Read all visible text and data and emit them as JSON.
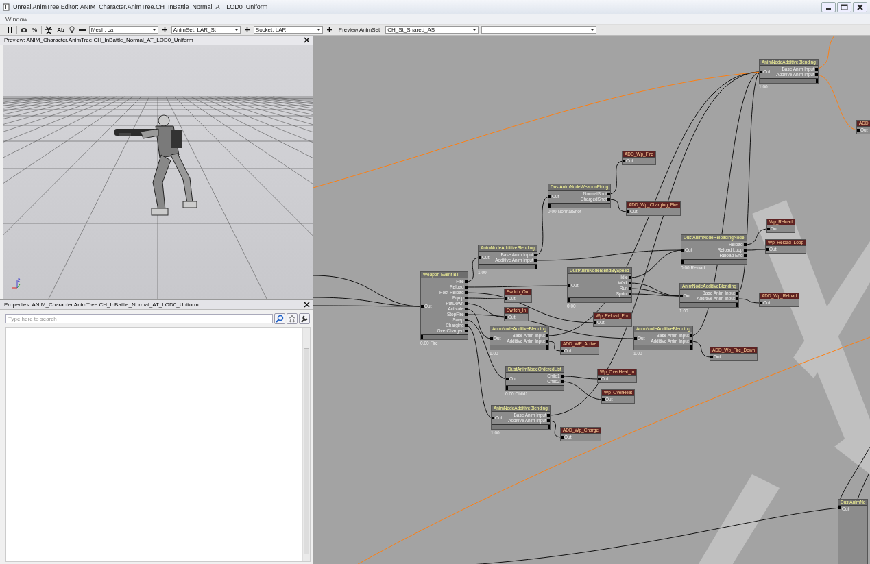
{
  "window": {
    "title": "Unreal AnimTree Editor: ANIM_Character.AnimTree.CH_InBattle_Normal_AT_LOD0_Uniform"
  },
  "menu_bar": [
    "Window"
  ],
  "toolbar": {
    "text_buttons": [
      "%",
      "Ab"
    ],
    "mesh_combo": "Mesh: ca",
    "animset_combo": "AnimSet: LAR_St",
    "socket_combo": "Socket: LAR",
    "preview_animset_label": "Preview AnimSet",
    "preview_animset_combo": "CH_St_Shared_AS"
  },
  "preview_panel": {
    "title": "Preview: ANIM_Character.AnimTree.CH_InBattle_Normal_AT_LOD0_Uniform"
  },
  "properties_panel": {
    "title": "Properties: ANIM_Character.AnimTree.CH_InBattle_Normal_AT_LOD0_Uniform",
    "search": {
      "placeholder": "Type here to search"
    }
  },
  "graph": {
    "nodes": [
      {
        "kind": "blend",
        "title": "AnimNodeAdditiveBlending",
        "out": "Out",
        "inputs": [
          "Base Anim Input",
          "Additive Anim Input"
        ],
        "level": 1,
        "footer": "1.00"
      },
      {
        "kind": "sequence",
        "title": "ADD",
        "out": "Out"
      },
      {
        "kind": "sequence",
        "title": "ADD_Wp_Fire",
        "out": "Out"
      },
      {
        "kind": "blend",
        "title": "DustAnimNodeWeaponFiring",
        "out": "Out",
        "inputs": [
          "NormalShot",
          "ChargedShot"
        ],
        "level": 0,
        "footer": "0.00 NormalShot"
      },
      {
        "kind": "sequence",
        "title": "ADD_Wp_Charging_Fire",
        "out": "Out"
      },
      {
        "kind": "sequence",
        "title": "Wp_Reload",
        "out": "Out"
      },
      {
        "kind": "sequence",
        "title": "Wp_Reload_Loop",
        "out": "Out"
      },
      {
        "kind": "blend",
        "title": "DustAnimNodeReloadingNode",
        "out": "Out",
        "inputs": [
          "Reload",
          "Reload Loop",
          "Reload End"
        ],
        "level": 0,
        "footer": "0.00 Reload"
      },
      {
        "kind": "blend",
        "title": "AnimNodeAdditiveBlending",
        "out": "Out",
        "inputs": [
          "Base Anim Input",
          "Additive Anim Input"
        ],
        "level": 1,
        "footer": "1.00"
      },
      {
        "kind": "blend",
        "title": "DustAnimNodeBlendBySpeed",
        "out": "Out",
        "inputs": [
          "Idle",
          "Walk",
          "Run",
          "Sprint"
        ],
        "level": 0,
        "footer": "0.00"
      },
      {
        "kind": "blend",
        "title": "Weapon Event BT",
        "out": "Out",
        "inputs": [
          "Fire",
          "Reload",
          "Post Reload",
          "Equip",
          "PutDown",
          "Activate",
          "StopFire",
          "Swap",
          "Charging",
          "OverCharged"
        ],
        "level": 0,
        "footer": "0.00 Fire"
      },
      {
        "kind": "blend",
        "title": "AnimNodeAdditiveBlending",
        "out": "Out",
        "inputs": [
          "Base Anim Input",
          "Additive Anim Input"
        ],
        "level": 1,
        "footer": "1.00"
      },
      {
        "kind": "sequence",
        "title": "ADD_Wp_Reload",
        "out": "Out"
      },
      {
        "kind": "sequence",
        "title": "Switch_Out",
        "out": "Out"
      },
      {
        "kind": "sequence",
        "title": "Switch_In",
        "out": "Out"
      },
      {
        "kind": "sequence",
        "title": "Wp_Reload_End",
        "out": "Out"
      },
      {
        "kind": "blend",
        "title": "AnimNodeAdditiveBlending",
        "out": "Out",
        "inputs": [
          "Base Anim Input",
          "Additive Anim Input"
        ],
        "level": 1,
        "footer": "1.00"
      },
      {
        "kind": "blend",
        "title": "AnimNodeAdditiveBlending",
        "out": "Out",
        "inputs": [
          "Base Anim Input",
          "Additive Anim Input"
        ],
        "level": 1,
        "footer": "1.00"
      },
      {
        "kind": "sequence",
        "title": "ADD_WP_Active",
        "out": "Out"
      },
      {
        "kind": "sequence",
        "title": "ADD_Wp_Fire_Down",
        "out": "Out"
      },
      {
        "kind": "blend",
        "title": "DustAnimNodeOrderedList",
        "out": "Out",
        "inputs": [
          "Child1",
          "Child2"
        ],
        "level": 0,
        "footer": "0.00 Child1"
      },
      {
        "kind": "sequence",
        "title": "Wp_OverHeat_In",
        "out": "Out"
      },
      {
        "kind": "sequence",
        "title": "Wp_OverHeat",
        "out": "Out"
      },
      {
        "kind": "blend",
        "title": "AnimNodeAdditiveBlending",
        "out": "Out",
        "inputs": [
          "Base Anim Input",
          "Additive Anim Input"
        ],
        "level": 1,
        "footer": "1.00"
      },
      {
        "kind": "sequence",
        "title": "ADD_Wp_Charge",
        "out": "Out"
      },
      {
        "kind": "blend",
        "title": "DustAnimNo",
        "out": "Out"
      }
    ]
  }
}
